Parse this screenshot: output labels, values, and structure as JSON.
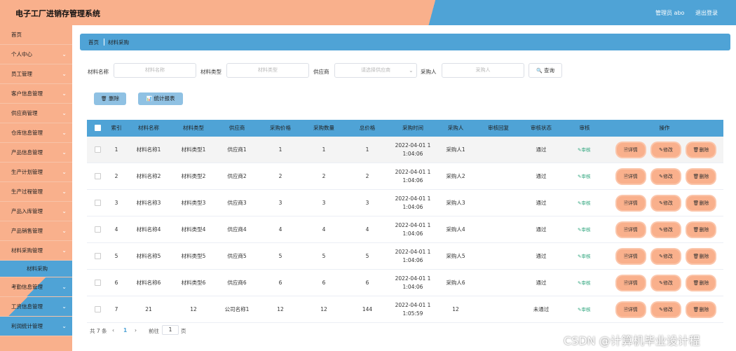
{
  "header": {
    "title": "电子工厂进销存管理系统",
    "user": "管理员 abo",
    "logout": "退出登录",
    "colors": {
      "left": "#f9b08c",
      "right": "#4fa3d6"
    }
  },
  "sidebar": {
    "items": [
      {
        "label": "首页",
        "chevron": false
      },
      {
        "label": "个人中心",
        "chevron": true
      },
      {
        "label": "员工管理",
        "chevron": true
      },
      {
        "label": "客户信息管理",
        "chevron": true
      },
      {
        "label": "供应商管理",
        "chevron": true
      },
      {
        "label": "仓库信息管理",
        "chevron": true
      },
      {
        "label": "产品信息管理",
        "chevron": true
      },
      {
        "label": "生产计划管理",
        "chevron": true
      },
      {
        "label": "生产过程管理",
        "chevron": true
      },
      {
        "label": "产品入库管理",
        "chevron": true
      },
      {
        "label": "产品销售管理",
        "chevron": true
      },
      {
        "label": "材料采购管理",
        "chevron": true
      }
    ],
    "active_sub": "材料采购",
    "items_after": [
      {
        "label": "考勤信息管理",
        "chevron": true
      },
      {
        "label": "工资信息管理",
        "chevron": true
      },
      {
        "label": "利润统计管理",
        "chevron": true
      }
    ],
    "chevron_glyph": "⌄"
  },
  "breadcrumb": {
    "home": "首页",
    "current": "材料采购"
  },
  "search": {
    "name_label": "材料名称",
    "name_placeholder": "材料名称",
    "type_label": "材料类型",
    "type_placeholder": "材料类型",
    "supplier_label": "供应商",
    "supplier_placeholder": "请选择供应商",
    "buyer_label": "采购人",
    "buyer_placeholder": "采购人",
    "query_label": "查询"
  },
  "actions": {
    "delete": "删除",
    "report": "统计报表"
  },
  "table": {
    "headers": [
      "索引",
      "材料名称",
      "材料类型",
      "供应商",
      "采购价格",
      "采购数量",
      "总价格",
      "采购时间",
      "采购人",
      "审核回复",
      "审核状态",
      "审核",
      "操作"
    ],
    "audit_label": "审核",
    "op_labels": {
      "detail": "详情",
      "edit": "修改",
      "delete": "删除"
    },
    "rows": [
      {
        "idx": "1",
        "name": "材料名称1",
        "type": "材料类型1",
        "supplier": "供应商1",
        "price": "1",
        "qty": "1",
        "total": "1",
        "time1": "2022-04-01 1",
        "time2": "1:04:06",
        "buyer": "采购人1",
        "reply": "",
        "status": "通过"
      },
      {
        "idx": "2",
        "name": "材料名称2",
        "type": "材料类型2",
        "supplier": "供应商2",
        "price": "2",
        "qty": "2",
        "total": "2",
        "time1": "2022-04-01 1",
        "time2": "1:04:06",
        "buyer": "采购人2",
        "reply": "",
        "status": "通过"
      },
      {
        "idx": "3",
        "name": "材料名称3",
        "type": "材料类型3",
        "supplier": "供应商3",
        "price": "3",
        "qty": "3",
        "total": "3",
        "time1": "2022-04-01 1",
        "time2": "1:04:06",
        "buyer": "采购人3",
        "reply": "",
        "status": "通过"
      },
      {
        "idx": "4",
        "name": "材料名称4",
        "type": "材料类型4",
        "supplier": "供应商4",
        "price": "4",
        "qty": "4",
        "total": "4",
        "time1": "2022-04-01 1",
        "time2": "1:04:06",
        "buyer": "采购人4",
        "reply": "",
        "status": "通过"
      },
      {
        "idx": "5",
        "name": "材料名称5",
        "type": "材料类型5",
        "supplier": "供应商5",
        "price": "5",
        "qty": "5",
        "total": "5",
        "time1": "2022-04-01 1",
        "time2": "1:04:06",
        "buyer": "采购人5",
        "reply": "",
        "status": "通过"
      },
      {
        "idx": "6",
        "name": "材料名称6",
        "type": "材料类型6",
        "supplier": "供应商6",
        "price": "6",
        "qty": "6",
        "total": "6",
        "time1": "2022-04-01 1",
        "time2": "1:04:06",
        "buyer": "采购人6",
        "reply": "",
        "status": "通过"
      },
      {
        "idx": "7",
        "name": "21",
        "type": "12",
        "supplier": "公司名称1",
        "price": "12",
        "qty": "12",
        "total": "144",
        "time1": "2022-04-01 1",
        "time2": "1:05:59",
        "buyer": "12",
        "reply": "",
        "status": "未通过"
      }
    ]
  },
  "pagination": {
    "total": "共 7 条",
    "prev": "‹",
    "page": "1",
    "next": "›",
    "goto": "前往",
    "goto_value": "1",
    "page_suffix": "页"
  },
  "watermark": "CSDN @计算机毕业设计程",
  "icons": {
    "delete": "🗑",
    "report": "📊",
    "search": "🔍",
    "edit": "✎",
    "detail": "🗎"
  }
}
